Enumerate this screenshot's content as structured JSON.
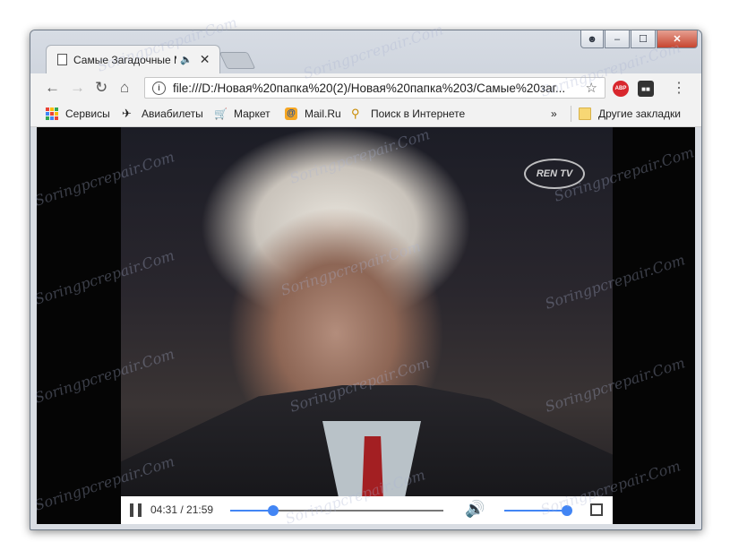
{
  "window": {
    "controls": {
      "minimize": "‒",
      "maximize": "☐",
      "close": "✕"
    }
  },
  "tab": {
    "title": "Самые Загадочные М",
    "close": "✕"
  },
  "toolbar": {
    "back": "←",
    "forward": "→",
    "reload": "↻",
    "home": "⌂",
    "url": "file:///D:/Новая%20папка%20(2)/Новая%20папка%203/Самые%20заг...",
    "star": "☆",
    "ext_abp": "ABP",
    "menu": "⋮"
  },
  "bookmarks": {
    "items": [
      {
        "label": "Сервисы",
        "icon": "apps-grid-icon"
      },
      {
        "label": "Авиабилеты",
        "icon": "plane-icon"
      },
      {
        "label": "Маркет",
        "icon": "cart-icon"
      },
      {
        "label": "Mail.Ru",
        "icon": "mailru-icon"
      },
      {
        "label": "Поиск в Интернете",
        "icon": "search-icon"
      }
    ],
    "overflow": "»",
    "other": "Другие закладки"
  },
  "video": {
    "channel_logo": "REN TV",
    "current_time": "04:31",
    "duration": "21:59",
    "time_display": "04:31 / 21:59",
    "progress_fraction": 0.2,
    "volume_fraction": 0.97
  },
  "watermark": "Soringpcrepair.Com",
  "colors": {
    "accent": "#4285f4",
    "abp_red": "#d8272d"
  }
}
